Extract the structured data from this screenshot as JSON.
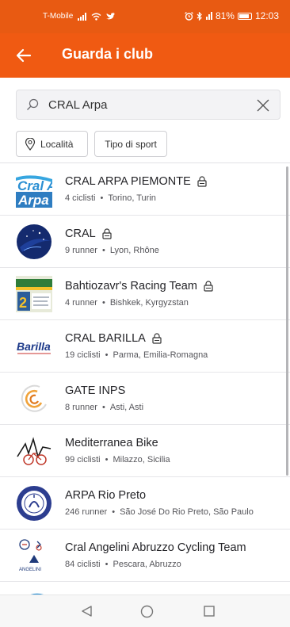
{
  "status_bar": {
    "carrier": "T-Mobile",
    "battery": "81%",
    "time": "12:03"
  },
  "app_bar": {
    "title": "Guarda i club"
  },
  "search": {
    "value": "CRAL Arpa",
    "placeholder": ""
  },
  "filters": {
    "location": "Località",
    "sport": "Tipo di sport"
  },
  "clubs": [
    {
      "name": "CRAL ARPA PIEMONTE",
      "private": true,
      "members": "4 ciclisti",
      "location": "Torino, Turin"
    },
    {
      "name": "CRAL",
      "private": true,
      "members": "9 runner",
      "location": "Lyon, Rhône"
    },
    {
      "name": "Bahtiozavr's Racing Team",
      "private": true,
      "members": "4 runner",
      "location": "Bishkek, Kyrgyzstan"
    },
    {
      "name": "CRAL BARILLA",
      "private": true,
      "members": "19 ciclisti",
      "location": "Parma, Emilia-Romagna"
    },
    {
      "name": "GATE INPS",
      "private": false,
      "members": "8 runner",
      "location": "Asti, Asti"
    },
    {
      "name": "Mediterranea Bike",
      "private": false,
      "members": "99 ciclisti",
      "location": "Milazzo, Sicilia"
    },
    {
      "name": "ARPA Rio Preto",
      "private": false,
      "members": "246 runner",
      "location": "São José Do Rio Preto, São Paulo"
    },
    {
      "name": "Cral Angelini Abruzzo Cycling Team",
      "private": false,
      "members": "84 ciclisti",
      "location": "Pescara, Abruzzo"
    }
  ],
  "logo_text": {
    "cral_arpa": "Cral Arpa",
    "barilla": "Barilla",
    "angelini": "ANGELINI"
  },
  "colors": {
    "brand_orange": "#f05a12",
    "status_orange": "#e85a12"
  }
}
